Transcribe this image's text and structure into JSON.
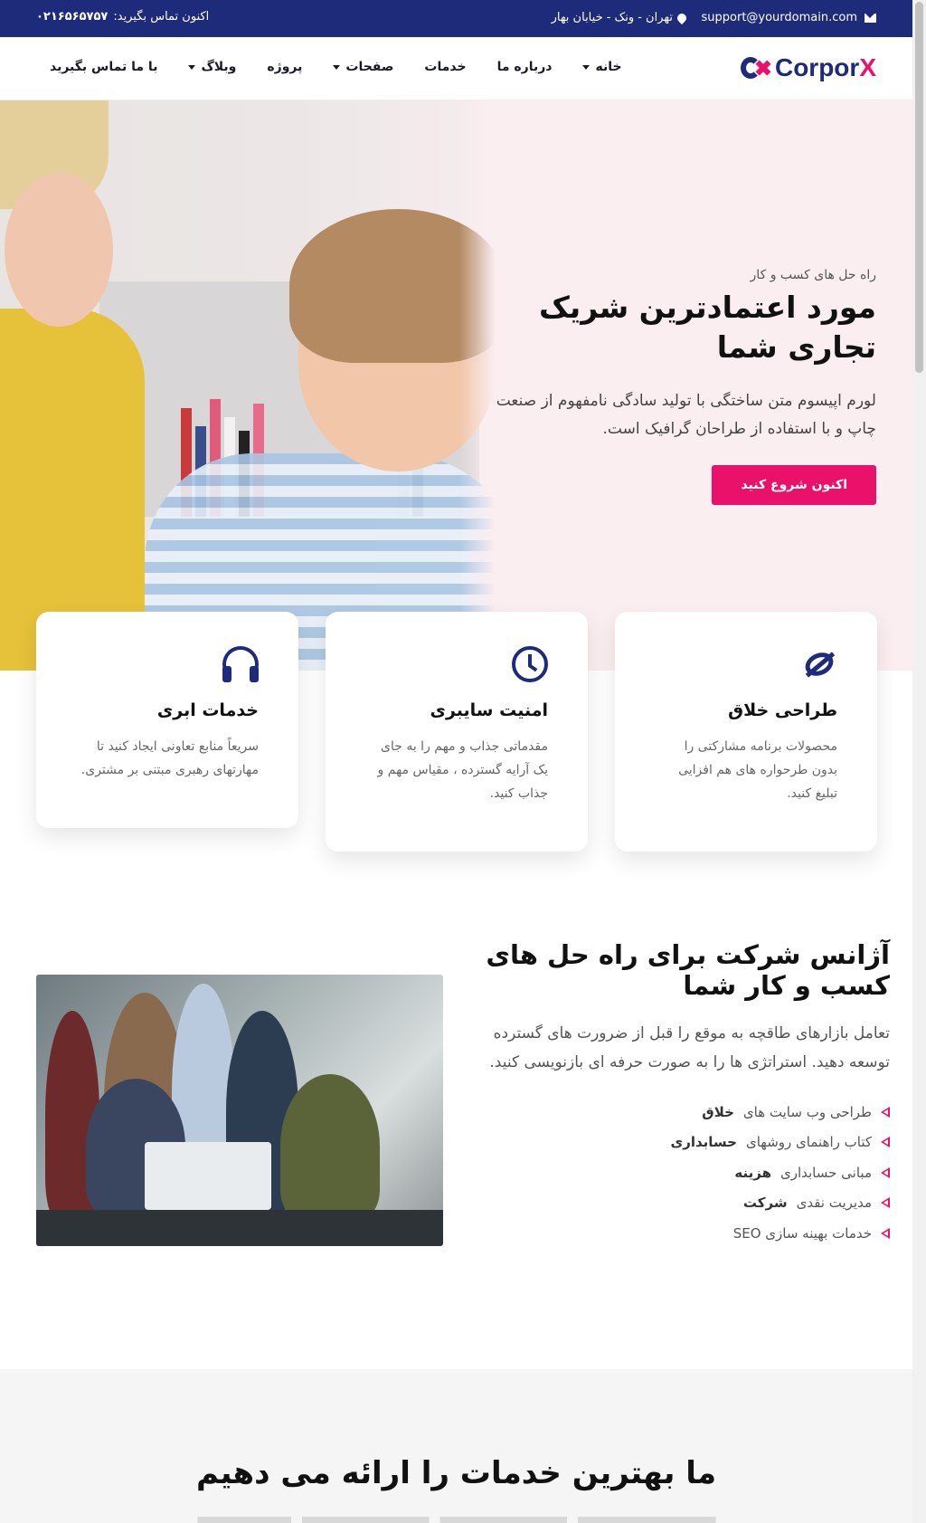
{
  "topbar": {
    "email": "support@yourdomain.com",
    "address": "تهران - ونک - خیابان بهار",
    "call_label": "اکنون تماس بگیرید:",
    "phone": "۰۲۱۶۵۶۵۷۵۷"
  },
  "nav": {
    "logo_prefix": "Corpor",
    "logo_x": "X",
    "items": [
      {
        "label": "خانه",
        "dropdown": true
      },
      {
        "label": "درباره ما",
        "dropdown": false
      },
      {
        "label": "خدمات",
        "dropdown": false
      },
      {
        "label": "صفحات",
        "dropdown": true
      },
      {
        "label": "پروژه",
        "dropdown": false
      },
      {
        "label": "وبلاگ",
        "dropdown": true
      },
      {
        "label": "با ما تماس بگیرید",
        "dropdown": false
      }
    ]
  },
  "hero": {
    "kicker": "راه حل های کسب و کار",
    "title": "مورد اعتمادترین شریک تجاری شما",
    "text": "لورم اپیسوم متن ساختگی با تولید سادگی نامفهوم از صنعت چاپ و با استفاده از طراحان گرافیک است.",
    "button": "اکنون شروع کنید"
  },
  "cards": [
    {
      "icon": "creative-design-icon",
      "title": "طراحی خلاق",
      "text": "محصولات برنامه مشارکتی را بدون طرحواره های هم افزایی تبلیغ کنید."
    },
    {
      "icon": "clock-icon",
      "title": "امنیت سایبری",
      "text": "مقدماتی جذاب و مهم را به جای یک آرایه گسترده ، مقیاس مهم و جذاب کنید."
    },
    {
      "icon": "headphones-icon",
      "title": "خدمات ابری",
      "text": "سریعاً منابع تعاونی ایجاد کنید تا مهارتهای رهبری مبتنی بر مشتری."
    }
  ],
  "about": {
    "title": "آژانس شرکت برای راه حل های کسب و کار شما",
    "text": "تعامل بازارهای طاقچه به موقع را قبل از ضرورت های گسترده توسعه دهید. استراتژی ها را به صورت حرفه ای بازنویسی کنید.",
    "list": [
      {
        "text": "طراحی وب سایت های",
        "bold": "خلاق"
      },
      {
        "text": "کتاب راهنمای روشهای",
        "bold": "حسابداری"
      },
      {
        "text": "مبانی حسابداری",
        "bold": "هزینه"
      },
      {
        "text": "مدیریت نقدی",
        "bold": "شرکت"
      },
      {
        "text": "خدمات بهینه سازی SEO",
        "bold": ""
      }
    ]
  },
  "services": {
    "title": "ما بهترین خدمات را ارائه می دهیم"
  },
  "colors": {
    "primary": "#1e2b7a",
    "accent": "#e9116a",
    "hero_bg": "#fbeef1"
  }
}
